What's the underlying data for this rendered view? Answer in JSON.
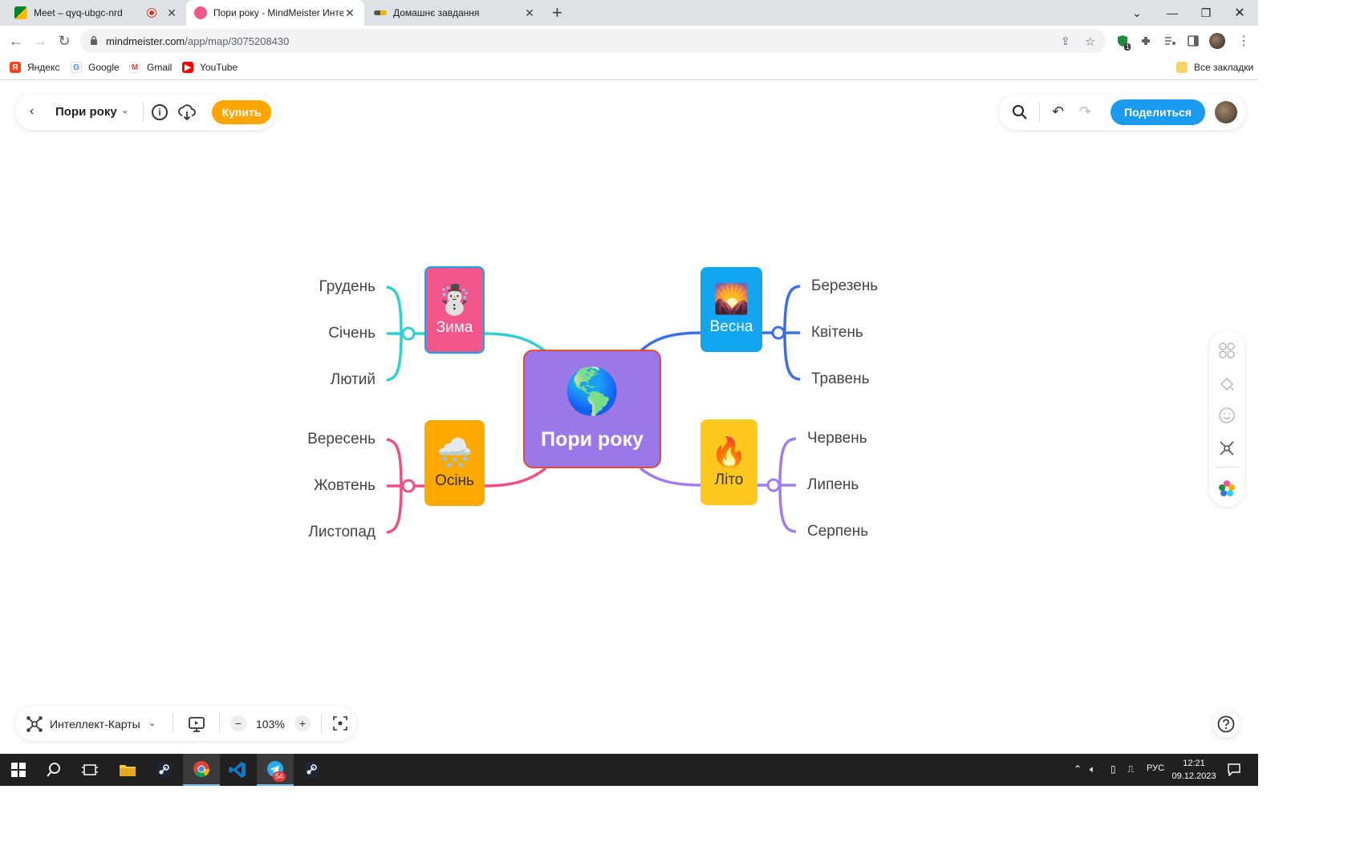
{
  "browser": {
    "tabs": [
      {
        "title": "Meet – qyq-ubgc-nrd",
        "active": false,
        "recording": true
      },
      {
        "title": "Пори року - MindMeister Инте",
        "active": true
      },
      {
        "title": "Домашнє завдання",
        "active": false
      }
    ],
    "url_host": "mindmeister.com",
    "url_path": "/app/map/3075208430",
    "extension_badge": "1",
    "bookmarks": [
      "Яндекс",
      "Google",
      "Gmail",
      "YouTube"
    ],
    "all_bookmarks": "Все закладки"
  },
  "app": {
    "map_name": "Пори року",
    "buy_label": "Купить",
    "share_label": "Поделиться",
    "layout_label": "Интеллект-Карты",
    "zoom": "103%",
    "info_glyph": "i",
    "back_glyph": "‹",
    "caret_glyph": "⌄",
    "undo_glyph": "↶",
    "redo_glyph": "↷",
    "minus_glyph": "−",
    "plus_glyph": "+"
  },
  "map": {
    "center": {
      "label": "Пори року",
      "emoji": "🌎",
      "color": "#9b78e8",
      "border": "#e04a3a"
    },
    "branches": {
      "winter": {
        "label": "Зима",
        "emoji": "☃️",
        "color": "#f2568b",
        "line": "#2ed0d3",
        "children": [
          "Грудень",
          "Січень",
          "Лютий"
        ]
      },
      "spring": {
        "label": "Весна",
        "emoji": "🌄",
        "color": "#13a6f0",
        "line": "#3a6fea",
        "children": [
          "Березень",
          "Квітень",
          "Травень"
        ]
      },
      "autumn": {
        "label": "Осінь",
        "emoji": "🌨️",
        "color": "#ffa800",
        "line": "#ef4f85",
        "children": [
          "Вересень",
          "Жовтень",
          "Листопад"
        ]
      },
      "summer": {
        "label": "Літо",
        "emoji": "🔥",
        "color": "#ffc81e",
        "line": "#a07cf0",
        "children": [
          "Червень",
          "Липень",
          "Серпень"
        ]
      }
    }
  },
  "taskbar": {
    "telegram_badge": "54",
    "language": "РУС",
    "time": "12:21",
    "date": "09.12.2023"
  }
}
